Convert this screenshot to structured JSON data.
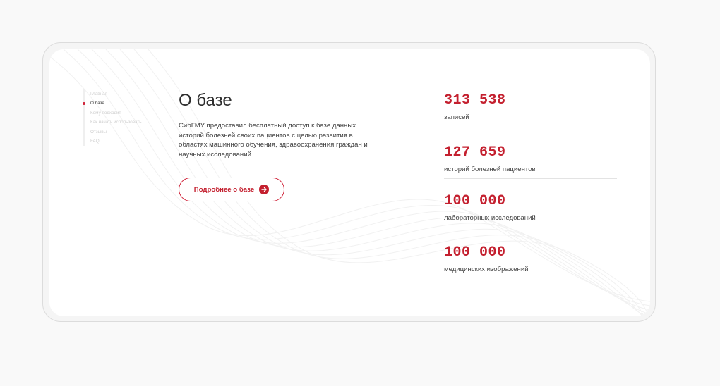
{
  "nav": {
    "items": [
      {
        "label": "Главная",
        "active": false
      },
      {
        "label": "О базе",
        "active": true
      },
      {
        "label": "Кому подходит",
        "active": false
      },
      {
        "label": "Как начать использовать",
        "active": false
      },
      {
        "label": "Отзывы",
        "active": false
      },
      {
        "label": "FAQ",
        "active": false
      }
    ]
  },
  "about": {
    "title": "О базе",
    "description": "СибГМУ предоставил бесплатный доступ к базе данных историй болезней своих пациентов с целью развития в областях машинного обучения, здравоохранения граждан и научных исследований.",
    "button_label": "Подробнее о базе",
    "button_icon": "arrow-right-circle-icon"
  },
  "stats": [
    {
      "value": "313 538",
      "label": "записей"
    },
    {
      "value": "127 659",
      "label": "историй болезней пациентов"
    },
    {
      "value": "100 000",
      "label": "лабораторных исследований"
    },
    {
      "value": "100 000",
      "label": "медицинских изображений"
    }
  ],
  "colors": {
    "accent": "#c4202f",
    "active_dot": "#d0243a",
    "text": "#2e2e2e",
    "muted": "#cfcfcf",
    "background": "#f9f9f9",
    "card": "#ffffff"
  }
}
